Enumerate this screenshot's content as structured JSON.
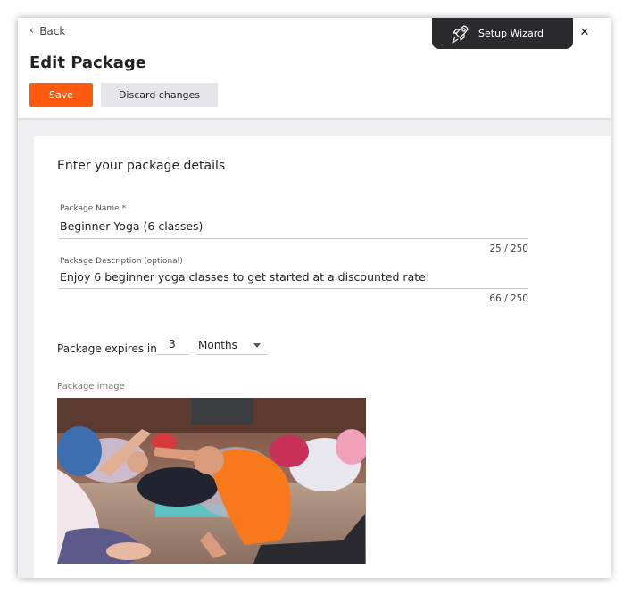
{
  "header": {
    "back_label": "Back",
    "title": "Edit Package",
    "save_label": "Save",
    "discard_label": "Discard changes"
  },
  "wizard": {
    "label": "Setup Wizard",
    "icon": "rocket-icon",
    "close_icon": "close-icon"
  },
  "form": {
    "section_title": "Enter your package details",
    "name": {
      "label": "Package Name *",
      "value": "Beginner Yoga (6 classes)",
      "counter": "25 / 250"
    },
    "description": {
      "label": "Package Description (optional)",
      "value": "Enjoy 6 beginner yoga classes to get started at a discounted rate!",
      "counter": "66 / 250"
    },
    "expires": {
      "label": "Package expires in",
      "value": "3",
      "unit": "Months"
    },
    "image": {
      "label": "Package image",
      "alt": "yoga class photo"
    }
  },
  "colors": {
    "accent": "#ff5a0f",
    "wizard_bg": "#2b2b2e",
    "shirt": "#f7791c"
  }
}
